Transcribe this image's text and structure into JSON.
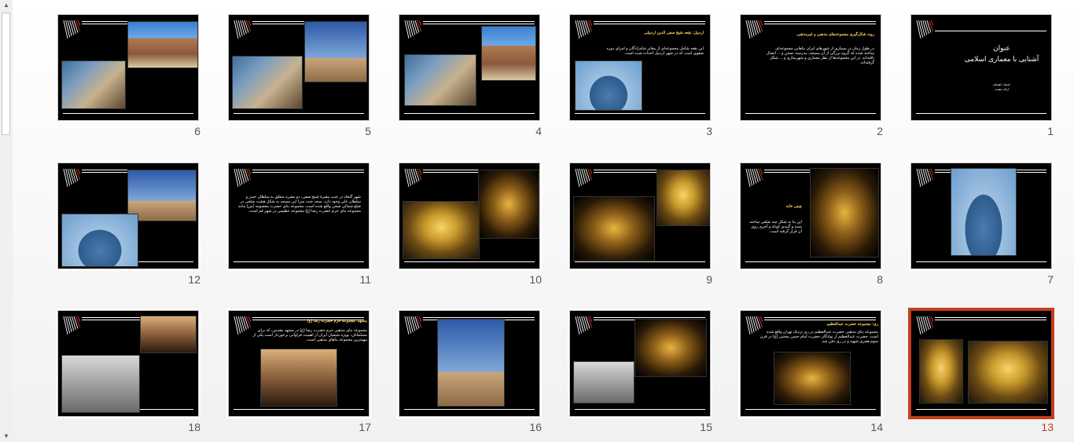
{
  "scrollbar": {
    "up": "▲",
    "down": "▼"
  },
  "slides": [
    {
      "num": "1",
      "title": "عنوان",
      "subtitle": "آشنایی با معماری اسلامی",
      "caption_line1": "استاد: اهتمام",
      "caption_line2": "ارائه دهنده:"
    },
    {
      "num": "2",
      "title": "روند شکل‌گیری مجموعه‌های مذهبی و غیرمذهبی",
      "body": "در طول زمان در بسیاری از شهرهای ایران بناهایی مجموعه‌ای ساخته شده که گروه بزرگی از آن مسجد، مدرسه، صحن و ... اتصال یافته‌اند. در این مجموعه‌ها از نظر معماری و شهرسازی و ... شکل گرفته‌اند."
    },
    {
      "num": "3",
      "title": "اردبیل: بقعه شیخ صفی الدین اردبیلی",
      "body": "این بقعه شامل مجموعه‌ای از مقابر شاه‌زادگان و امرای دوره صفوی است که در شهر اردبیل احداث شده است."
    },
    {
      "num": "4"
    },
    {
      "num": "5"
    },
    {
      "num": "6"
    },
    {
      "num": "7"
    },
    {
      "num": "8",
      "title": "چینی خانه",
      "body": "این بنا به شکل چند ضلعی ساخته شده و گنبدی کوتاه و آجری روی آن قرار گرفته است."
    },
    {
      "num": "9"
    },
    {
      "num": "10"
    },
    {
      "num": "11",
      "body": "شهر گنجاد در جنب مقبرۀ شیخ صفی، دو مقبره متعلق به سلطان حیدر و سلطان علی وجود دارد. سجد جنت سرا این مسجد به شکل هشت ضلعی در ضلع شمالی صحن واقع شده است. مجموعه بنای حضرت معصومه (س) مانند مجموعه بنای حرم حضرت رضا (ع) مجموعه عظیمی در شهر قم است."
    },
    {
      "num": "12"
    },
    {
      "num": "13"
    },
    {
      "num": "14",
      "title": "ری: مجموعه حضرت عبدالعظیم",
      "body": "مجموعه بنای مذهبی حضرت عبدالعظیم در ری نزدیک تهران واقع شده است. حضرت عبدالعظیم از نوادگان حضرت امام حسن مجتبی (ع) در قرن سوم هجری شهید و در ری دفن شد."
    },
    {
      "num": "15"
    },
    {
      "num": "16"
    },
    {
      "num": "17",
      "title": "مشهد: مجموعه حرم حضرت رضا (ع)",
      "body": "مجموعه بنای مذهبی حرم حضرت رضا (ع) در مشهد مقدس، که برای مسلمانان، بویژه شیعیان ایران از اهمیت فراوانی برخوردار است یکی از مهمترین مجموعه بناهای مذهبی است."
    },
    {
      "num": "18"
    }
  ]
}
